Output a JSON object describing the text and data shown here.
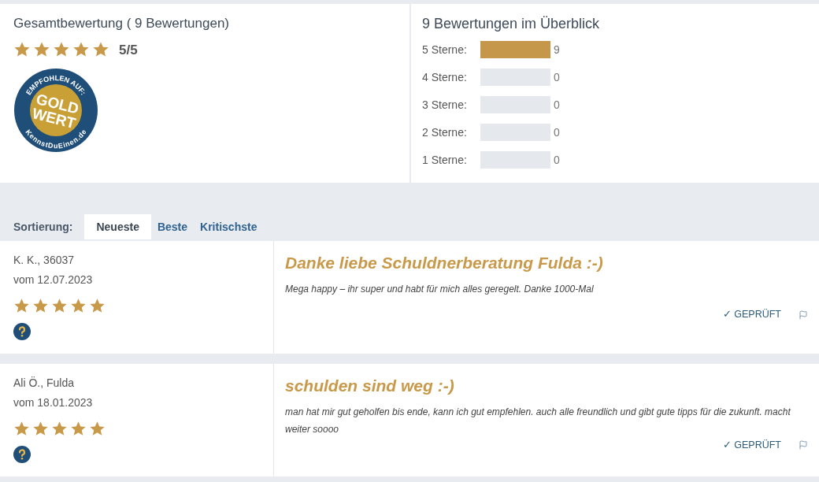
{
  "summary": {
    "title": "Gesamtbewertung ( 9 Bewertungen)",
    "stars": 5,
    "score": "5/5",
    "badge": {
      "top": "EMPFOHLEN AUF:",
      "line_1": "GOLD",
      "line_2": "WERT",
      "bottom": "KennstDuEinen.de"
    }
  },
  "overview": {
    "title": "9 Bewertungen im Überblick",
    "rows": [
      {
        "label": "5 Sterne:",
        "level": 1,
        "count": "9"
      },
      {
        "label": "4 Sterne:",
        "level": 0,
        "count": "0"
      },
      {
        "label": "3 Sterne:",
        "level": 0,
        "count": "0"
      },
      {
        "label": "2 Sterne:",
        "level": 0,
        "count": "0"
      },
      {
        "label": "1 Sterne:",
        "level": 0,
        "count": "0"
      }
    ]
  },
  "sorting": {
    "label": "Sortierung:",
    "tabs": [
      {
        "label": "Neueste",
        "selected": true
      },
      {
        "label": "Beste",
        "selected": false
      },
      {
        "label": "Kritischste",
        "selected": false
      }
    ]
  },
  "reviews": [
    {
      "author": "K. K., 36037",
      "date": "vom 12.07.2023",
      "stars": 5,
      "title": "Danke liebe Schuldnerberatung Fulda :-)",
      "text": "Mega happy – ihr super und habt für mich alles geregelt. Danke 1000-Mal",
      "verified": "✓ GEPRÜFT"
    },
    {
      "author": "Ali Ö., Fulda",
      "date": "vom 18.01.2023",
      "stars": 5,
      "title": "schulden sind weg :-)",
      "text": "man hat mir gut geholfen bis ende, kann ich gut empfehlen. auch alle freundlich und gibt gute tipps für die zukunft. macht weiter soooo",
      "verified": "✓ GEPRÜFT"
    }
  ]
}
